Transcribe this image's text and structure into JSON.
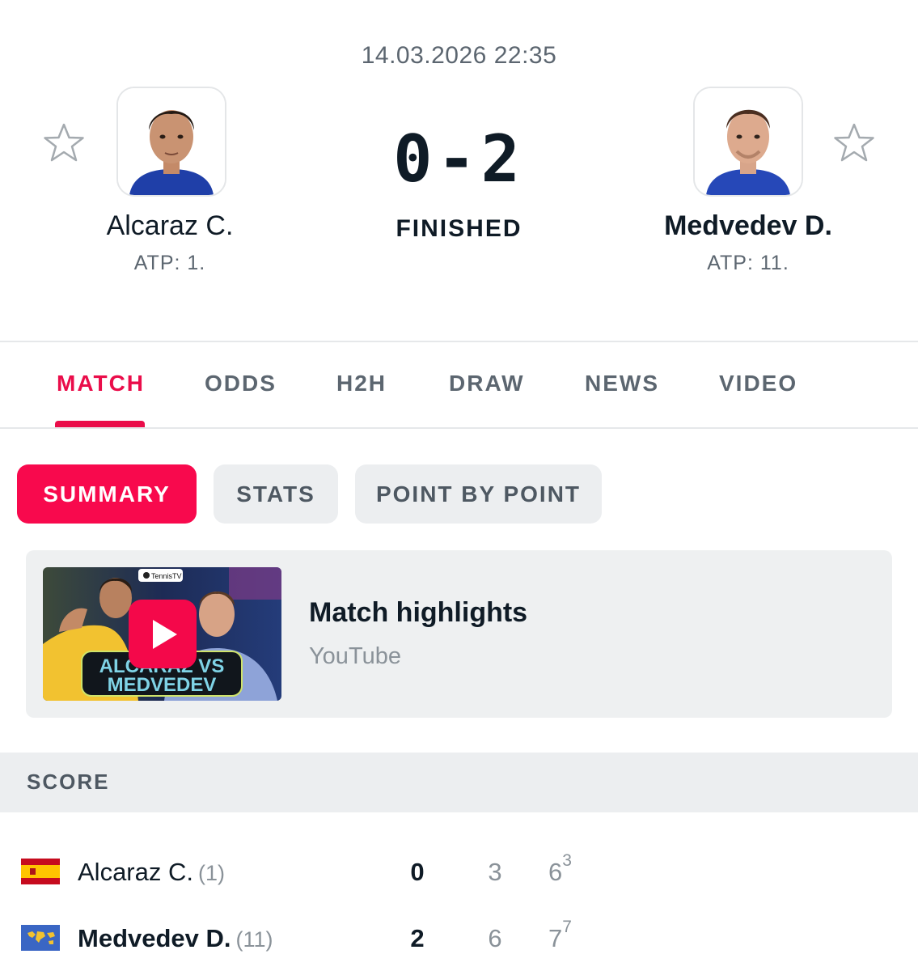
{
  "match": {
    "datetime": "14.03.2026 22:35",
    "score": "0-2",
    "status": "FINISHED"
  },
  "players": [
    {
      "name": "Alcaraz C.",
      "rank": "ATP: 1.",
      "seed": "(1)",
      "sets_won": "0",
      "flag": "spain-flag-icon",
      "sets": [
        {
          "games": "3",
          "tiebreak": ""
        },
        {
          "games": "6",
          "tiebreak": "3"
        }
      ]
    },
    {
      "name": "Medvedev D.",
      "rank": "ATP: 11.",
      "seed": "(11)",
      "sets_won": "2",
      "flag": "neutral-flag-icon",
      "sets": [
        {
          "games": "6",
          "tiebreak": ""
        },
        {
          "games": "7",
          "tiebreak": "7"
        }
      ]
    }
  ],
  "tabs": [
    "MATCH",
    "ODDS",
    "H2H",
    "DRAW",
    "NEWS",
    "VIDEO"
  ],
  "active_tab": "MATCH",
  "subtabs": [
    "SUMMARY",
    "STATS",
    "POINT BY POINT"
  ],
  "active_subtab": "SUMMARY",
  "video": {
    "title": "Match highlights",
    "source": "YouTube",
    "thumbnail_text": [
      "ALCARAZ VS",
      "MEDVEDEV"
    ],
    "thumbnail_badge": "TennisTV"
  },
  "score_section": {
    "title": "SCORE"
  },
  "colors": {
    "accent": "#f8094d",
    "active_tab": "#ea0d4a",
    "text": "#0f1b26",
    "muted": "#5c6670"
  }
}
